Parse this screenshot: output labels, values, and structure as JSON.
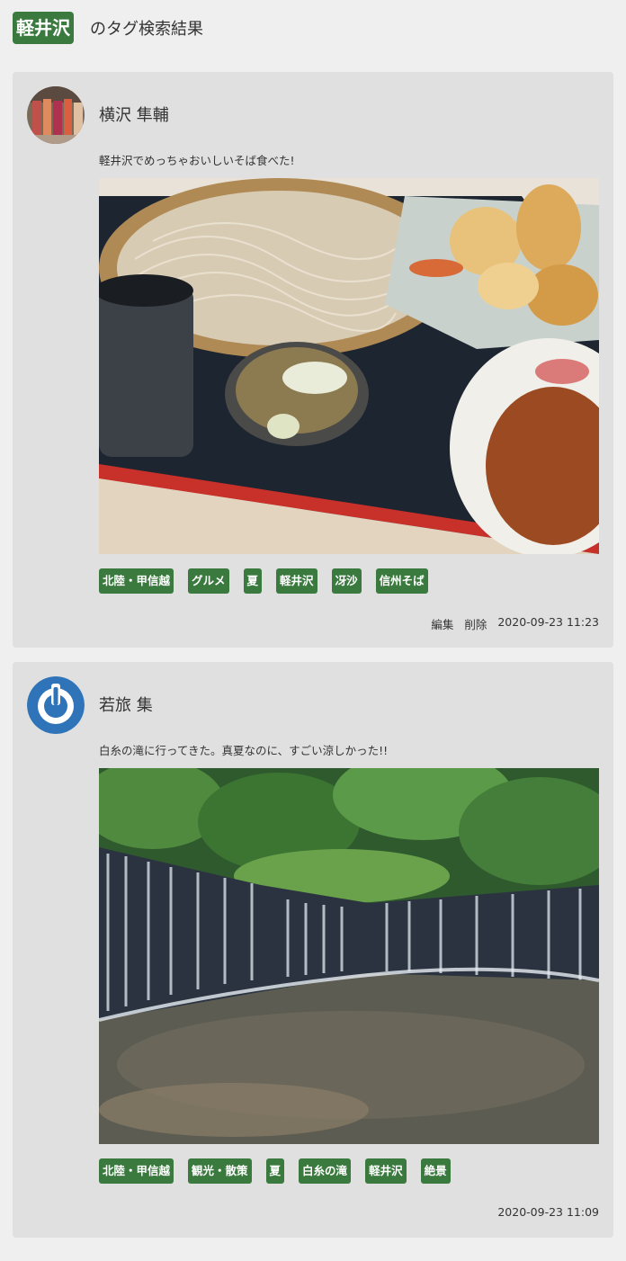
{
  "header": {
    "tag": "軽井沢",
    "title": "のタグ検索結果"
  },
  "posts": [
    {
      "user": "横沢 隼輔",
      "text": "軽井沢でめっちゃおいしいそば食べた!",
      "tags": [
        "北陸・甲信越",
        "グルメ",
        "夏",
        "軽井沢",
        "冴沙",
        "信州そば"
      ],
      "edit": "編集",
      "delete": "削除",
      "timestamp": "2020-09-23 11:23"
    },
    {
      "user": "若旅 集",
      "text": "白糸の滝に行ってきた。真夏なのに、すごい涼しかった!!",
      "tags": [
        "北陸・甲信越",
        "観光・散策",
        "夏",
        "白糸の滝",
        "軽井沢",
        "絶景"
      ],
      "timestamp": "2020-09-23 11:09"
    }
  ]
}
